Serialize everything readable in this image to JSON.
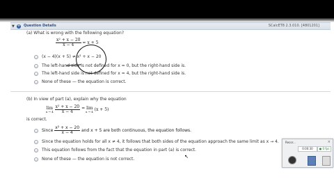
{
  "header": {
    "toggle": "▼",
    "plus": "+",
    "title": "Question Details",
    "ref": "SCalcET8 2.3.010. [4801201]"
  },
  "part_a": {
    "question": "(a) What is wrong with the following equation?",
    "eq_num": "x² + x − 20",
    "eq_den": "x − 4",
    "eq_rhs": "= x + 5",
    "options": [
      "(x − 4)(x + 5) ≠ x² + x − 20",
      "The left-hand side is not defined for x = 0, but the right-hand side is.",
      "The left-hand side is not defined for x = 4, but the right-hand side is.",
      "None of these — the equation is correct."
    ]
  },
  "part_b": {
    "question": "(b) In view of part (a), explain why the equation",
    "lim_left": "lim",
    "lim_sub": "x → 4",
    "eq_num": "x² + x − 20",
    "eq_den": "x − 4",
    "eq_mid": "= lim",
    "eq_rhs": "(x + 5)",
    "is_correct": "is correct.",
    "options": [
      {
        "pre": "Since",
        "num": "x² + x − 20",
        "den": "x − 4",
        "post": "and x + 5 are both continuous, the equation follows."
      },
      {
        "text": "Since the equation holds for all x ≠ 4, it follows that both sides of the equation approach the same limit as x → 4."
      },
      {
        "text": "This equation follows from the fact that the equation in part (a) is correct."
      },
      {
        "text": "None of these — the equation is not correct."
      }
    ]
  },
  "recorder": {
    "title": "Recor...",
    "close": "×",
    "time": "0:00:30",
    "level": "● 0 fps"
  },
  "cursor": "↖",
  "colors": {
    "title_bar": "#2a4f86",
    "background": "#ffffff"
  }
}
